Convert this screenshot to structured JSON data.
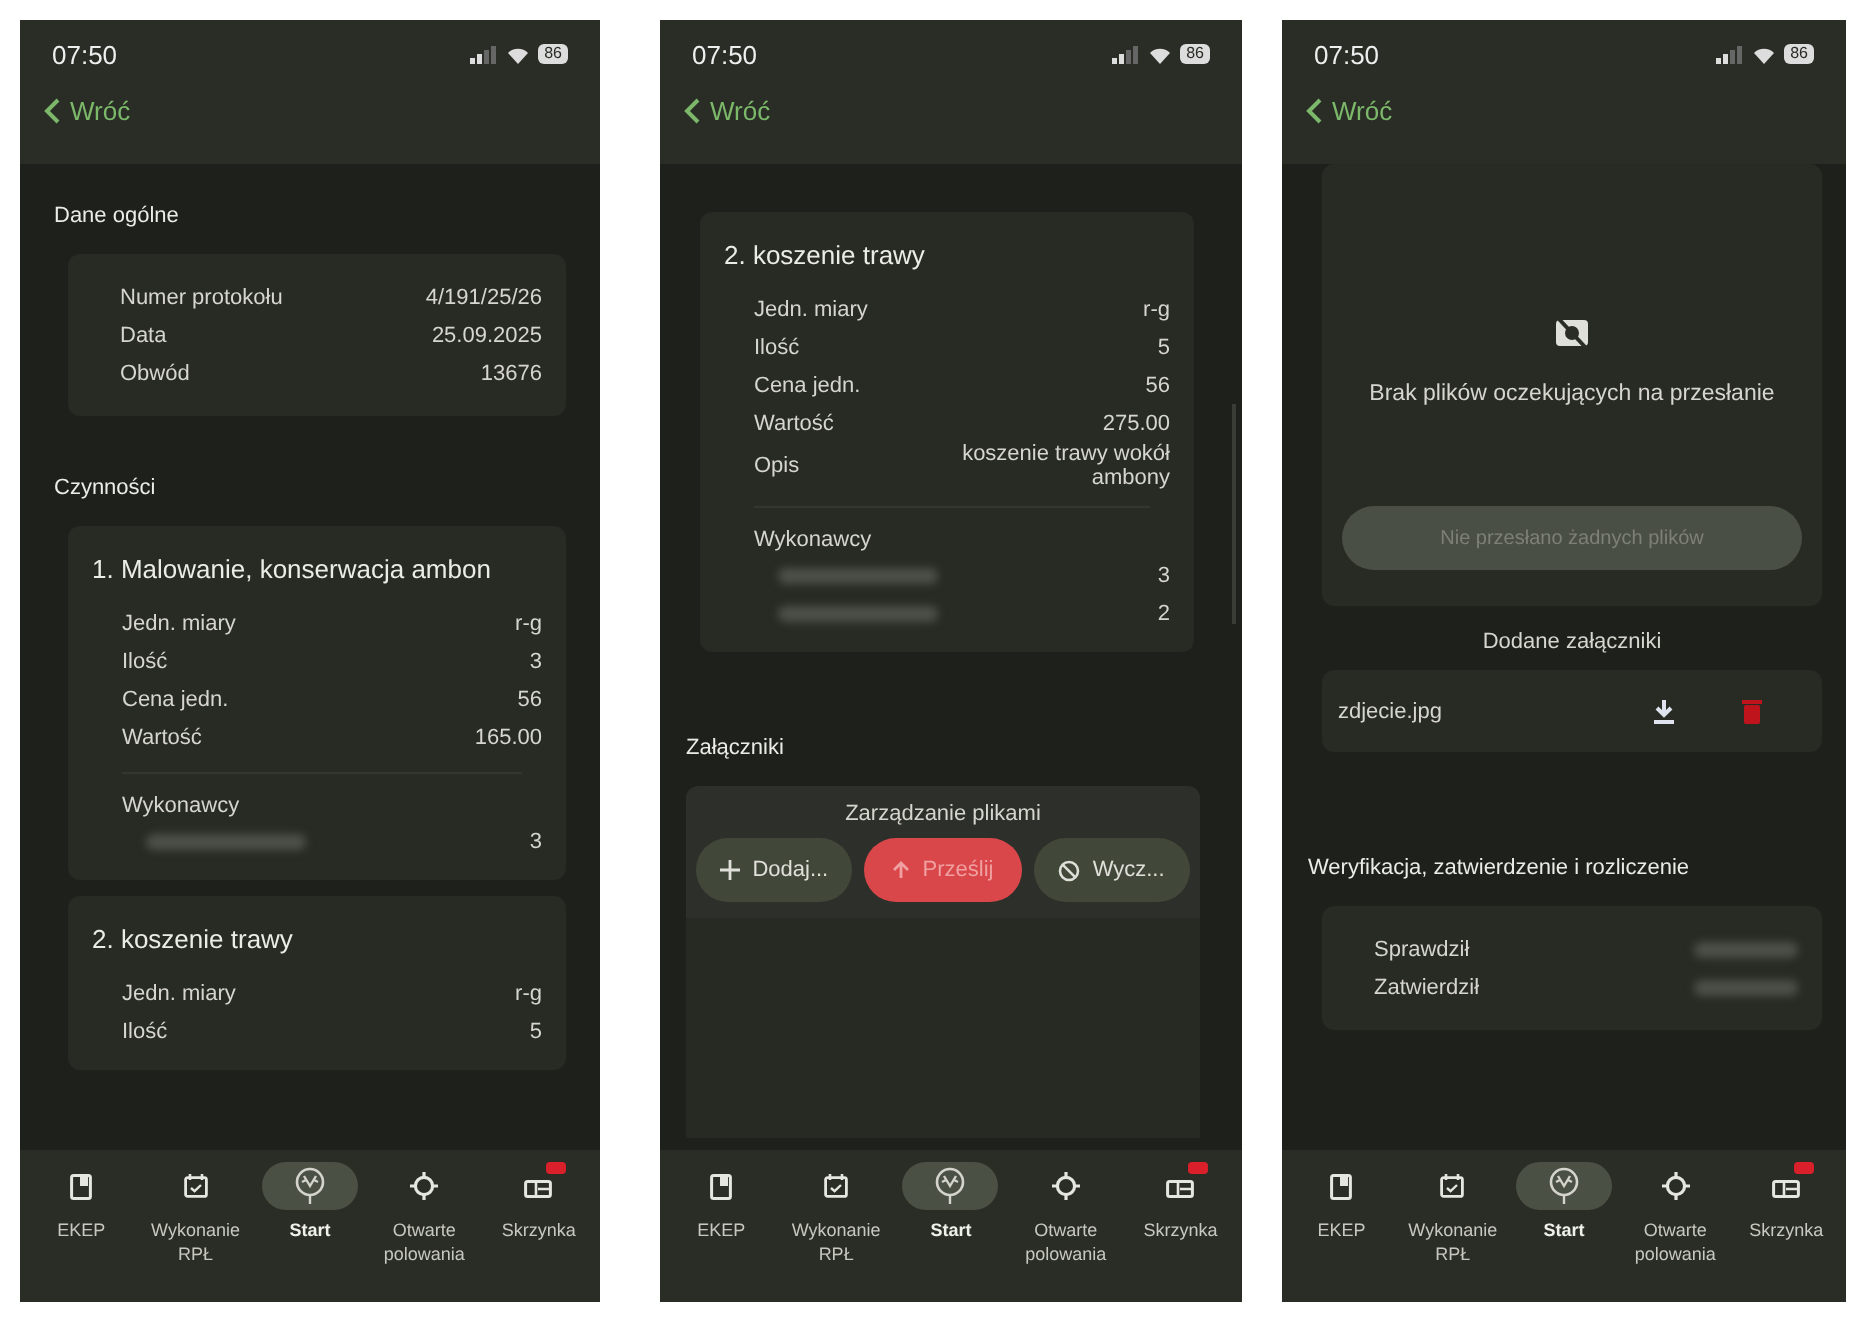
{
  "screens": [
    {
      "status": {
        "time": "07:50",
        "battery": "86"
      },
      "back": "Wróć",
      "blocks": [
        {
          "kind": "section",
          "title": "Dane ogólne"
        },
        {
          "kind": "kv",
          "rows": [
            {
              "label": "Numer protokołu",
              "value": "4/191/25/26"
            },
            {
              "label": "Data",
              "value": "25.09.2025"
            },
            {
              "label": "Obwód",
              "value": "13676"
            }
          ]
        },
        {
          "kind": "section",
          "title": "Czynności"
        },
        {
          "kind": "activity",
          "title": "1. Malowanie, konserwacja ambon",
          "rows": [
            {
              "label": "Jedn. miary",
              "value": "r-g"
            },
            {
              "label": "Ilość",
              "value": "3"
            },
            {
              "label": "Cena jedn.",
              "value": "56"
            },
            {
              "label": "Wartość",
              "value": "165.00"
            }
          ],
          "performers_label": "Wykonawcy",
          "performers": [
            {
              "count": "3"
            }
          ]
        },
        {
          "kind": "activity",
          "title": "2. koszenie trawy",
          "rows": [
            {
              "label": "Jedn. miary",
              "value": "r-g"
            },
            {
              "label": "Ilość",
              "value": "5"
            }
          ]
        }
      ],
      "nav": [
        {
          "label": "EKEP",
          "selected": false,
          "badge": false
        },
        {
          "label": "Wykonanie RPŁ",
          "selected": false,
          "badge": false
        },
        {
          "label": "Start",
          "selected": true,
          "badge": false
        },
        {
          "label": "Otwarte polowania",
          "selected": false,
          "badge": false
        },
        {
          "label": "Skrzynka",
          "selected": false,
          "badge": true
        }
      ]
    },
    {
      "status": {
        "time": "07:50",
        "battery": "86"
      },
      "back": "Wróć",
      "blocks": [
        {
          "kind": "activity",
          "title": "2. koszenie trawy",
          "rows": [
            {
              "label": "Jedn. miary",
              "value": "r-g"
            },
            {
              "label": "Ilość",
              "value": "5"
            },
            {
              "label": "Cena jedn.",
              "value": "56"
            },
            {
              "label": "Wartość",
              "value": "275.00"
            },
            {
              "label": "Opis",
              "value": "koszenie trawy wokół ambony"
            }
          ],
          "performers_label": "Wykonawcy",
          "performers": [
            {
              "count": "3"
            },
            {
              "count": "2"
            }
          ]
        },
        {
          "kind": "section",
          "title": "Załączniki"
        },
        {
          "kind": "manager",
          "title": "Zarządzanie plikami",
          "buttons": [
            {
              "kind": "add",
              "label": "Dodaj...",
              "disabled": false
            },
            {
              "kind": "upload",
              "label": "Prześlij",
              "disabled": true
            },
            {
              "kind": "clear",
              "label": "Wycz...",
              "disabled": false
            }
          ]
        }
      ],
      "nav": [
        {
          "label": "EKEP",
          "selected": false,
          "badge": false
        },
        {
          "label": "Wykonanie RPŁ",
          "selected": false,
          "badge": false
        },
        {
          "label": "Start",
          "selected": true,
          "badge": false
        },
        {
          "label": "Otwarte polowania",
          "selected": false,
          "badge": false
        },
        {
          "label": "Skrzynka",
          "selected": false,
          "badge": true
        }
      ]
    },
    {
      "status": {
        "time": "07:50",
        "battery": "86"
      },
      "back": "Wróć",
      "blocks": [
        {
          "kind": "empty",
          "message": "Brak plików oczekujących na przesłanie",
          "button": {
            "label": "Nie przesłano żadnych plików",
            "disabled": true
          }
        },
        {
          "kind": "caption",
          "title": "Dodane załączniki"
        },
        {
          "kind": "files",
          "files": [
            {
              "name": "zdjecie.jpg"
            }
          ]
        },
        {
          "kind": "section",
          "title": "Weryfikacja, zatwierdzenie i rozliczenie"
        },
        {
          "kind": "kv",
          "rows": [
            {
              "label": "Sprawdził"
            },
            {
              "label": "Zatwierdził"
            }
          ]
        }
      ],
      "nav": [
        {
          "label": "EKEP",
          "selected": false,
          "badge": false
        },
        {
          "label": "Wykonanie RPŁ",
          "selected": false,
          "badge": false
        },
        {
          "label": "Start",
          "selected": true,
          "badge": false
        },
        {
          "label": "Otwarte polowania",
          "selected": false,
          "badge": false
        },
        {
          "label": "Skrzynka",
          "selected": false,
          "badge": true
        }
      ]
    }
  ]
}
